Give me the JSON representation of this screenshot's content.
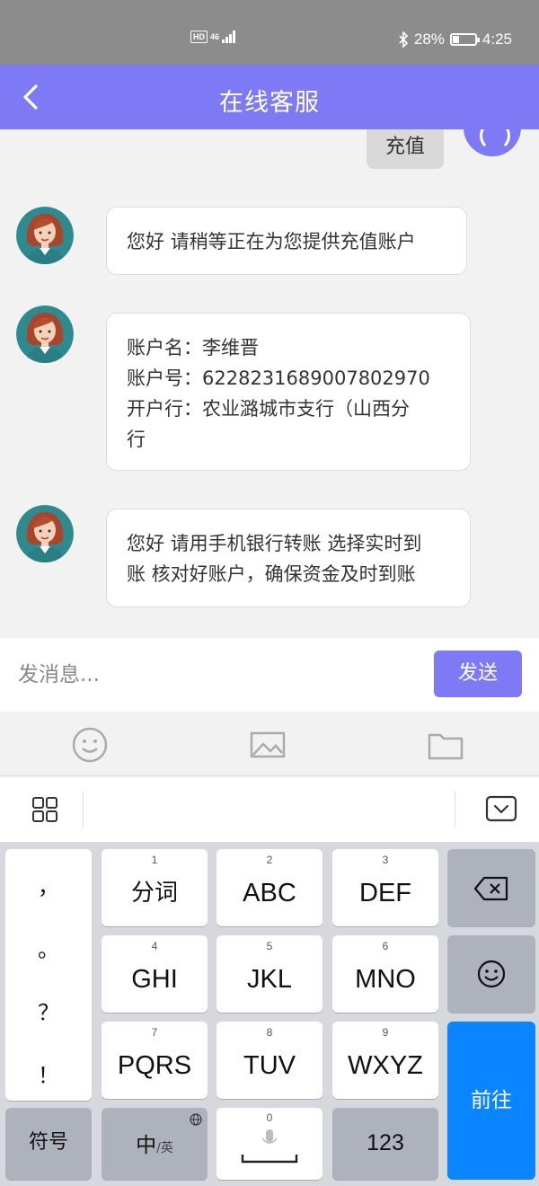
{
  "status_bar": {
    "hd_label": "HD",
    "network_label": "46",
    "battery_percent": "28%",
    "battery_level": 0.28,
    "time": "4:25",
    "icons": [
      "bluetooth-icon",
      "battery-icon",
      "signal-icon"
    ]
  },
  "header": {
    "title": "在线客服",
    "back_icon": "chevron-left-icon"
  },
  "chat": {
    "sent_message": "充值",
    "messages": [
      {
        "sender": "service",
        "text": "您好  请稍等正在为您提供充值账户"
      },
      {
        "sender": "service",
        "lines": [
          "账户名：李维晋",
          "账户号：6228231689007802970",
          "开户行：农业潞城市支行（山西分",
          "行"
        ]
      },
      {
        "sender": "service",
        "lines": [
          "您好 请用手机银行转账 选择实时到",
          "账 核对好账户，确保资金及时到账"
        ]
      }
    ]
  },
  "input": {
    "placeholder": "发消息...",
    "send_label": "发送"
  },
  "tools": [
    "emoji-icon",
    "image-icon",
    "folder-icon"
  ],
  "keyboard": {
    "punctuation": [
      "，",
      "。",
      "？",
      "！"
    ],
    "keys": [
      {
        "num": "1",
        "label": "分词"
      },
      {
        "num": "2",
        "label": "ABC"
      },
      {
        "num": "3",
        "label": "DEF"
      },
      {
        "num": "4",
        "label": "GHI"
      },
      {
        "num": "5",
        "label": "JKL"
      },
      {
        "num": "6",
        "label": "MNO"
      },
      {
        "num": "7",
        "label": "PQRS"
      },
      {
        "num": "8",
        "label": "TUV"
      },
      {
        "num": "9",
        "label": "WXYZ"
      }
    ],
    "symbol_label": "符号",
    "lang_main": "中",
    "lang_alt": "/英",
    "space_num": "0",
    "numeric_label": "123",
    "enter_label": "前往"
  },
  "colors": {
    "accent": "#7e7af5",
    "status_bar": "#8c8c8c",
    "enter_key": "#0a84ff"
  }
}
